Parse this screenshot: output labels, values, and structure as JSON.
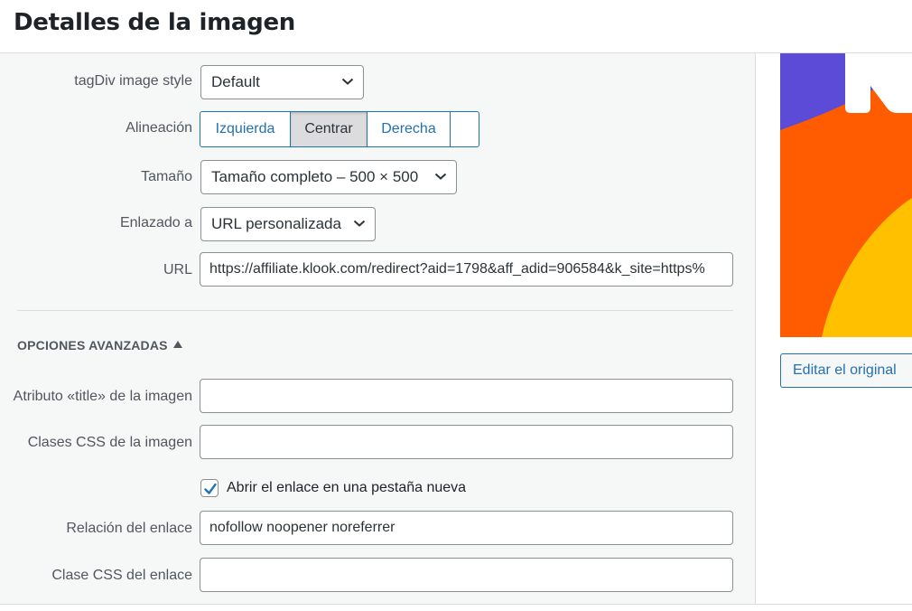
{
  "header": {
    "title": "Detalles de la imagen"
  },
  "fields": {
    "style": {
      "label": "tagDiv image style",
      "value": "Default"
    },
    "align": {
      "label": "Alineación",
      "options": [
        "Izquierda",
        "Centrar",
        "Derecha",
        ""
      ],
      "selected": "Centrar"
    },
    "size": {
      "label": "Tamaño",
      "value": "Tamaño completo – 500 × 500"
    },
    "link_to": {
      "label": "Enlazado a",
      "value": "URL personalizada"
    },
    "url": {
      "label": "URL",
      "value": "https://affiliate.klook.com/redirect?aid=1798&aff_adid=906584&k_site=https%"
    }
  },
  "advanced": {
    "toggle_label": "OPCIONES AVANZADAS",
    "title_attr": {
      "label": "Atributo «title» de la imagen",
      "value": ""
    },
    "image_css": {
      "label": "Clases CSS de la imagen",
      "value": ""
    },
    "new_tab": {
      "label": "Abrir el enlace en una pestaña nueva",
      "checked": true
    },
    "link_rel": {
      "label": "Relación del enlace",
      "value": "nofollow noopener noreferrer"
    },
    "link_css": {
      "label": "Clase CSS del enlace",
      "value": ""
    }
  },
  "sidebar": {
    "edit_original": "Editar el original"
  },
  "colors": {
    "accent": "#2271b1",
    "preview_purple": "#5b4bd6",
    "preview_orange": "#ff5b00",
    "preview_yellow": "#ffc000"
  }
}
